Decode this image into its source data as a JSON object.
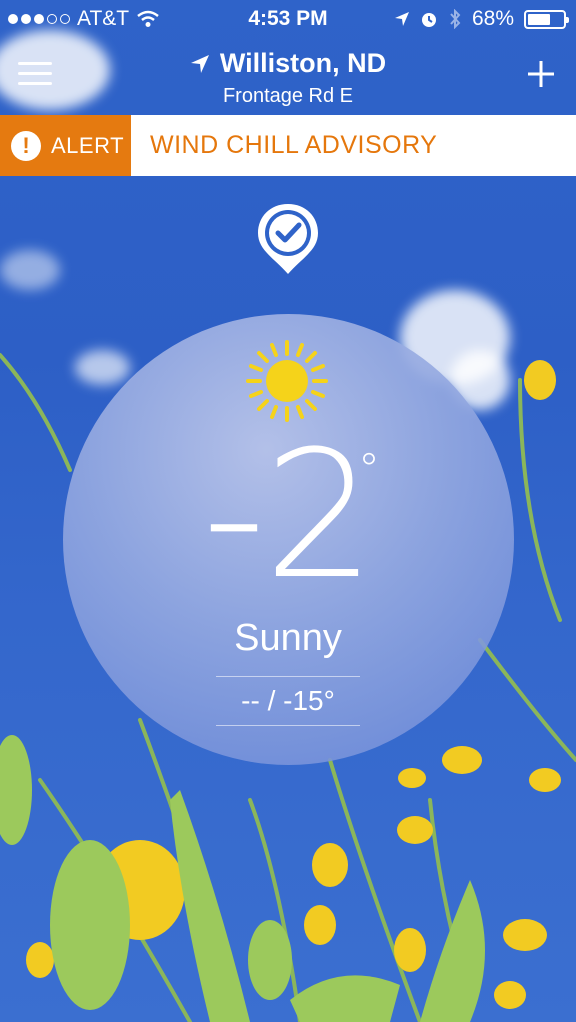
{
  "status_bar": {
    "carrier": "AT&T",
    "time": "4:53 PM",
    "battery": "68%",
    "battery_level": 0.68,
    "signal_bars_filled": 3,
    "signal_bars_total": 5
  },
  "header": {
    "city": "Williston, ND",
    "street": "Frontage Rd E"
  },
  "alert": {
    "tag": "ALERT",
    "icon_glyph": "!",
    "message": "WIND CHILL ADVISORY",
    "color": "#e57a10"
  },
  "weather": {
    "temperature": "-2",
    "degree_symbol": "°",
    "condition": "Sunny",
    "hi_lo": "-- / -15°",
    "condition_icon": "sun-icon"
  },
  "colors": {
    "sky": "#2f63c9",
    "sun": "#f5d31a",
    "alert_text": "#e5770c"
  }
}
